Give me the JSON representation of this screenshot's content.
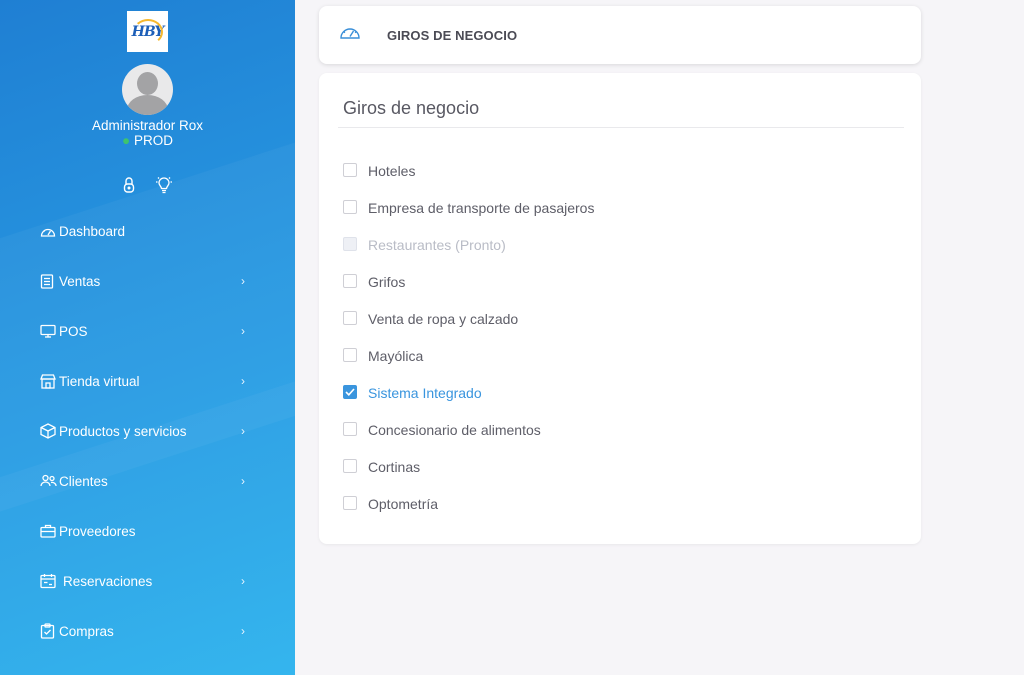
{
  "sidebar": {
    "logo_text": "HBY",
    "user": {
      "name": "Administrador Rox",
      "env_prefix": "●",
      "env": "PROD"
    },
    "tools": [
      {
        "icon": "lock-icon"
      },
      {
        "icon": "lightbulb-icon"
      }
    ],
    "menu": [
      {
        "label": "Dashboard",
        "icon": "dashboard-icon",
        "has_children": false
      },
      {
        "label": "Ventas",
        "icon": "receipt-icon",
        "has_children": true
      },
      {
        "label": "POS",
        "icon": "monitor-icon",
        "has_children": true
      },
      {
        "label": "Tienda virtual",
        "icon": "store-icon",
        "has_children": true
      },
      {
        "label": "Productos y servicios",
        "icon": "box-icon",
        "has_children": true
      },
      {
        "label": "Clientes",
        "icon": "users-icon",
        "has_children": true
      },
      {
        "label": "Proveedores",
        "icon": "briefcase-icon",
        "has_children": false
      },
      {
        "label": "Reservaciones",
        "icon": "calendar-icon",
        "has_children": true
      },
      {
        "label": "Compras",
        "icon": "clipboard-check-icon",
        "has_children": true
      }
    ],
    "chevron": "›"
  },
  "header": {
    "icon": "speedometer-icon",
    "title": "GIROS DE NEGOCIO"
  },
  "content": {
    "title": "Giros de negocio",
    "options": [
      {
        "label": "Hoteles",
        "checked": false,
        "disabled": false
      },
      {
        "label": "Empresa de transporte de pasajeros",
        "checked": false,
        "disabled": false
      },
      {
        "label": "Restaurantes (Pronto)",
        "checked": false,
        "disabled": true
      },
      {
        "label": "Grifos",
        "checked": false,
        "disabled": false
      },
      {
        "label": "Venta de ropa y calzado",
        "checked": false,
        "disabled": false
      },
      {
        "label": "Mayólica",
        "checked": false,
        "disabled": false
      },
      {
        "label": "Sistema Integrado",
        "checked": true,
        "disabled": false
      },
      {
        "label": "Concesionario de alimentos",
        "checked": false,
        "disabled": false
      },
      {
        "label": "Cortinas",
        "checked": false,
        "disabled": false
      },
      {
        "label": "Optometría",
        "checked": false,
        "disabled": false
      }
    ]
  },
  "colors": {
    "sidebar_top": "#1f7fd3",
    "sidebar_bottom": "#2cb2ee",
    "accent": "#3a95de",
    "env_dot": "#3ec46d"
  }
}
